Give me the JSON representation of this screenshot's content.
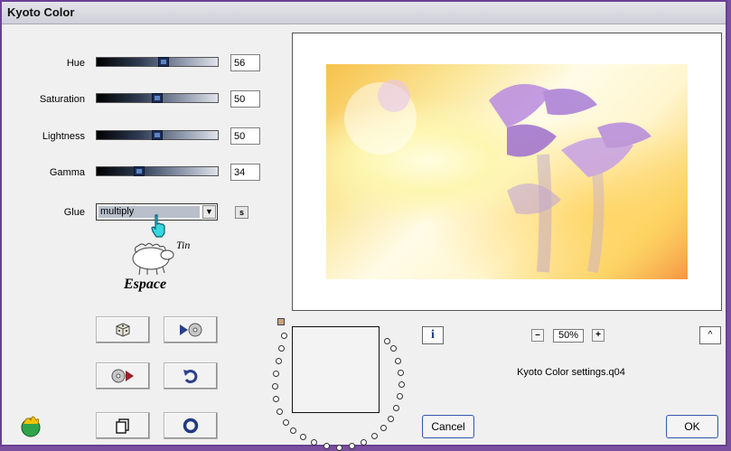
{
  "window": {
    "title": "Kyoto Color"
  },
  "sliders": [
    {
      "label": "Hue",
      "value": "56",
      "fraction": 0.56
    },
    {
      "label": "Saturation",
      "value": "50",
      "fraction": 0.5
    },
    {
      "label": "Lightness",
      "value": "50",
      "fraction": 0.5
    },
    {
      "label": "Gamma",
      "value": "34",
      "fraction": 0.34
    }
  ],
  "glue": {
    "label": "Glue",
    "selected": "multiply",
    "s_button": "s"
  },
  "logo": {
    "text": "Espace",
    "side_letters": "Tin"
  },
  "zoom": {
    "minus": "–",
    "value": "50%",
    "plus": "+"
  },
  "info_button": "i",
  "collapse_button": "^",
  "settings_file": "Kyoto Color settings.q04",
  "buttons": {
    "cancel": "Cancel",
    "ok": "OK"
  },
  "colors": {
    "title_bar": "#d8d9e0",
    "slider_thumb": "#1d2f55",
    "window_border": "#6a3f94",
    "preview_flowers": "#b98be0"
  }
}
